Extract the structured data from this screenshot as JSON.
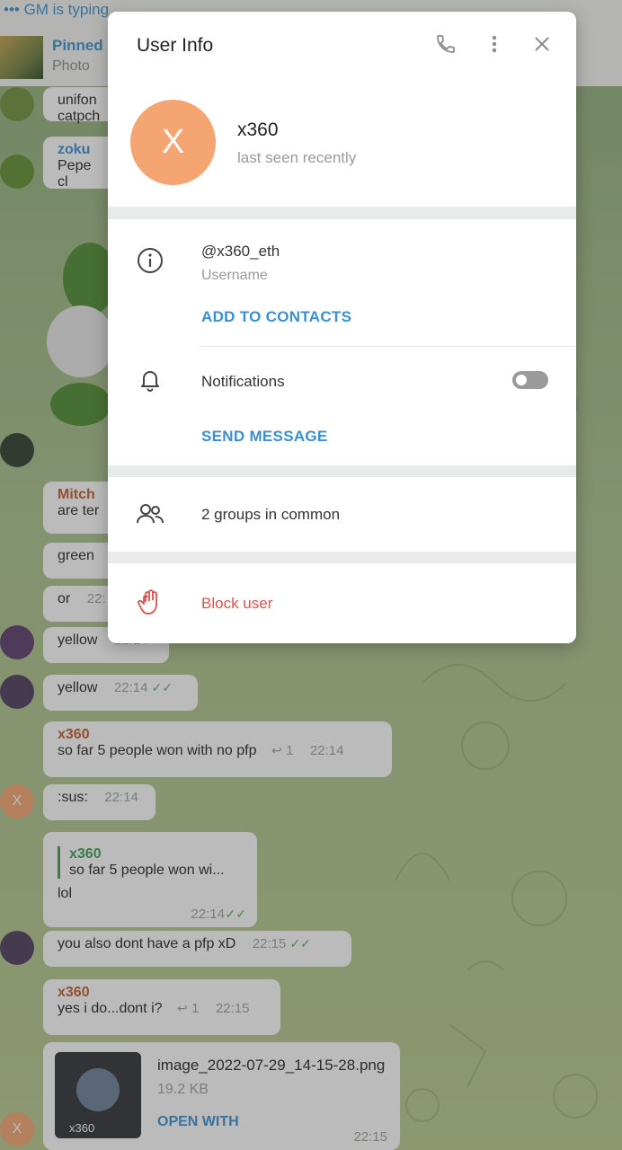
{
  "top": {
    "typing_status": "••• GM is typing",
    "pinned_label": "Pinned",
    "pinned_sub": "Photo"
  },
  "chat": {
    "b1_text": "unifon\ncatpch",
    "b2_sender": "zoku",
    "b2_text": "Pepe cl",
    "b3_sender": "Mitch",
    "b3_text": "are ter",
    "b4_text": "green",
    "b5_text": "or",
    "b5_time": "22:",
    "b6_text": "yellow",
    "b6_time": "22:14",
    "b7_text": "yellow",
    "b7_time": "22:14",
    "b8_sender": "x360",
    "b8_text": "so far 5 people won with no pfp",
    "b8_replies": "1",
    "b8_time": "22:14",
    "b9_text": ":sus:",
    "b9_time": "22:14",
    "b10_quote_sender": "x360",
    "b10_quote_text": "so far 5 people won wi...",
    "b10_text": "lol",
    "b10_time": "22:14",
    "b11_text": "you also dont have a pfp xD",
    "b11_time": "22:15",
    "b12_sender": "x360",
    "b12_text": "yes i do...dont i?",
    "b12_replies": "1",
    "b12_time": "22:15",
    "file_name": "image_2022-07-29_14-15-28.png",
    "file_size": "19.2 KB",
    "file_action": "OPEN WITH",
    "file_thumb_label": "x360",
    "file_time": "22:15",
    "avatar_letter": "X"
  },
  "modal": {
    "title": "User Info",
    "avatar_letter": "X",
    "name": "x360",
    "last_seen": "last seen recently",
    "username": "@x360_eth",
    "username_label": "Username",
    "add_contacts": "ADD TO CONTACTS",
    "notifications": "Notifications",
    "notifications_on": false,
    "send_message": "SEND MESSAGE",
    "groups_common": "2 groups in common",
    "block_user": "Block user"
  },
  "colors": {
    "accent": "#3a8fd0",
    "avatar": "#f4a571",
    "danger": "#d9534f"
  }
}
